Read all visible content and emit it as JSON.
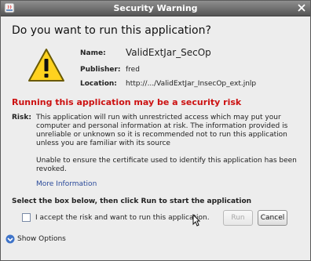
{
  "window": {
    "title": "Security Warning"
  },
  "dialog": {
    "heading": "Do you want to run this application?",
    "name_label": "Name:",
    "name_value": "ValidExtJar_SecOp",
    "publisher_label": "Publisher:",
    "publisher_value": "fred",
    "location_label": "Location:",
    "location_value": "http://.../ValidExtJar_InsecOp_ext.jnlp",
    "risk_title": "Running this application may be a security risk",
    "risk_label": "Risk:",
    "risk_text": "This application will run with unrestricted access which may put your computer and personal information at risk. The information provided is unreliable or unknown so it is recommended not to run this application unless you are familiar with its source",
    "cert_text": "Unable to ensure the certificate used to identify this application has been revoked.",
    "more_info": "More Information",
    "select_instruction": "Select the box below, then click Run to start the application",
    "accept_label": "I accept the risk and want to run this application.",
    "accept_checked": false,
    "run_label": "Run",
    "run_enabled": false,
    "cancel_label": "Cancel",
    "show_options": "Show Options"
  },
  "colors": {
    "risk": "#cc1111",
    "titlebar": "#6b6b6b",
    "link": "#2a4a9a"
  },
  "icons": [
    "java-icon",
    "close-icon",
    "warning-icon",
    "expand-options-icon",
    "mouse-cursor-icon"
  ]
}
